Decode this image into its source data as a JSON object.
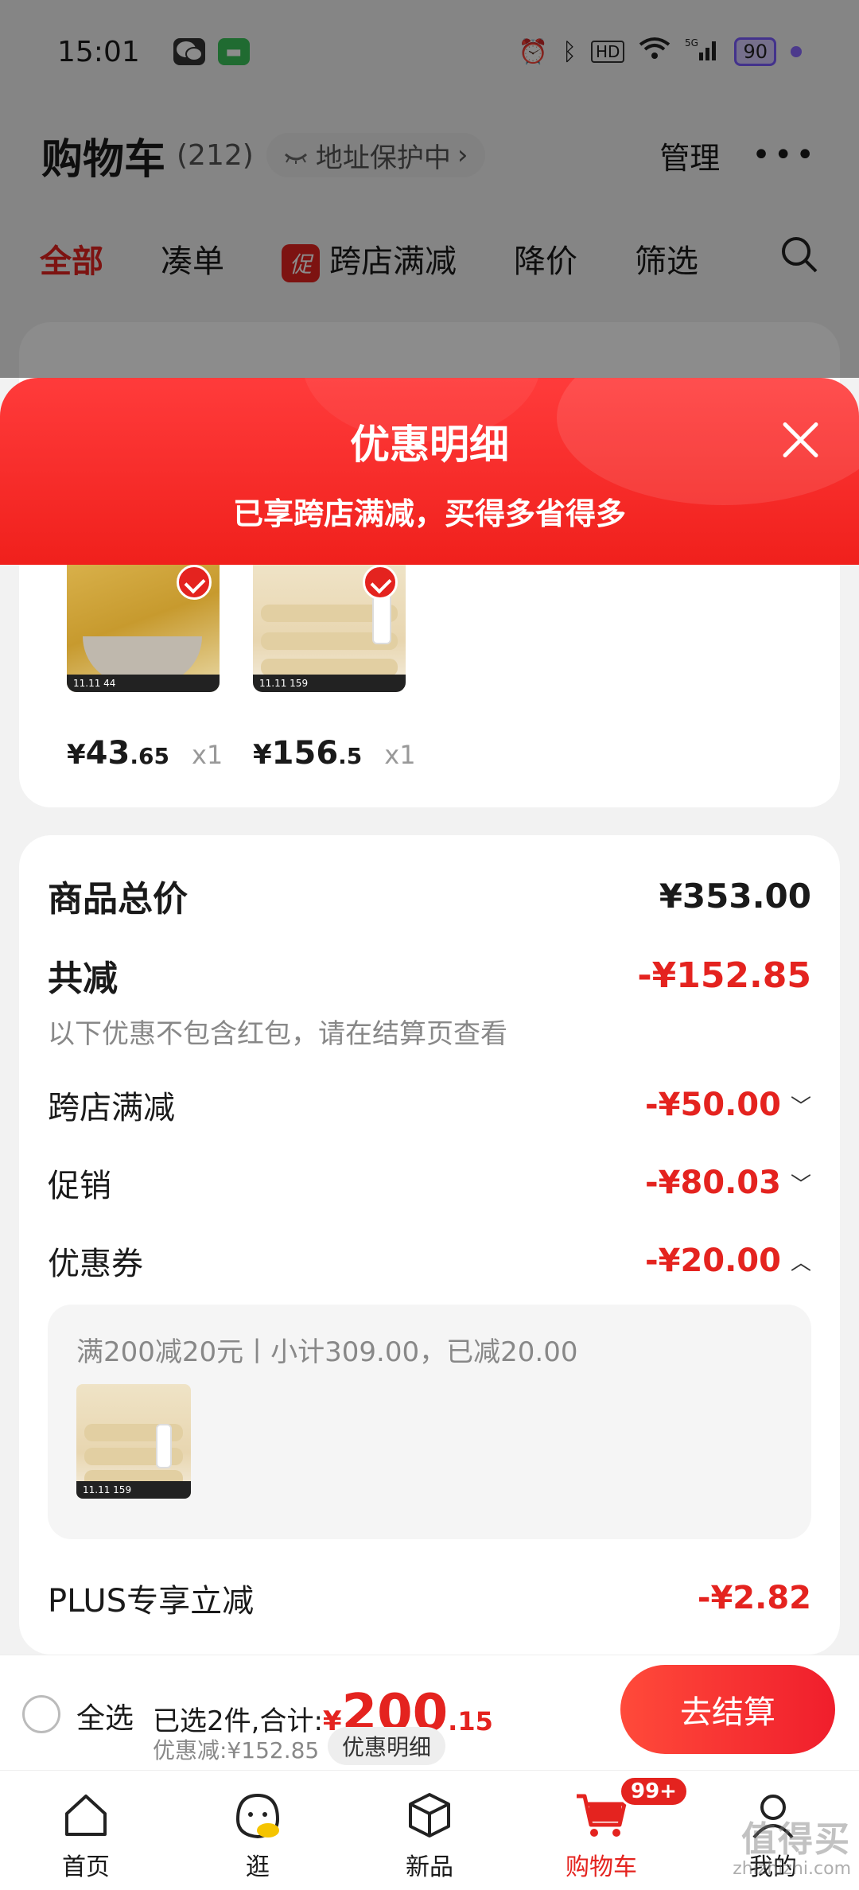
{
  "status_bar": {
    "time": "15:01",
    "battery": "90",
    "icons": [
      "wechat-icon",
      "message-app-icon",
      "alarm-icon",
      "bluetooth-icon",
      "hd-icon",
      "wifi-icon",
      "5g-signal-icon",
      "battery-icon"
    ]
  },
  "header": {
    "title": "购物车",
    "count": "(212)",
    "address_pill": "地址保护中",
    "manage": "管理",
    "more": "•••"
  },
  "filter_tabs": {
    "items": [
      "全部",
      "凑单",
      "跨店满减",
      "降价",
      "筛选"
    ],
    "promo_badge": "促",
    "active": "全部"
  },
  "sheet": {
    "title": "优惠明细",
    "subtitle": "已享跨店满减，买得多省得多"
  },
  "products": [
    {
      "price_yen": "¥",
      "price_int": "43",
      "price_dec": ".65",
      "qty": "x1",
      "strip": "11.11  44"
    },
    {
      "price_yen": "¥",
      "price_int": "156",
      "price_dec": ".5",
      "qty": "x1",
      "strip": "11.11  159"
    }
  ],
  "details": {
    "total_label": "商品总价",
    "total_value": "¥353.00",
    "saved_label": "共减",
    "saved_value": "-¥152.85",
    "note": "以下优惠不包含红包，请在结算页查看",
    "lines": [
      {
        "label": "跨店满减",
        "value": "-¥50.00",
        "chevron": "﹀"
      },
      {
        "label": "促销",
        "value": "-¥80.03",
        "chevron": "﹀"
      },
      {
        "label": "优惠券",
        "value": "-¥20.00",
        "chevron": "︿"
      }
    ],
    "coupon_desc": "满200减20元丨小计309.00，已减20.00",
    "plus_label": "PLUS专享立减",
    "plus_value": "-¥2.82"
  },
  "checkout": {
    "select_all": "全选",
    "selected_prefix": "已选2件,合计:",
    "total_yen": "¥",
    "total_int": "200",
    "total_dec": ".15",
    "saved_text": "优惠减:¥152.85",
    "detail_chip": "优惠明细",
    "button": "去结算"
  },
  "bottom_nav": {
    "items": [
      "首页",
      "逛",
      "新品",
      "购物车",
      "我的"
    ],
    "active": "购物车",
    "cart_badge": "99+"
  },
  "watermark": {
    "text": "值得买",
    "domain": "zhizhizhi.com"
  },
  "colors": {
    "accent": "#e4231f",
    "sheet_header": "#f0201c",
    "text_primary": "#1a1a1a",
    "text_muted": "#888888"
  }
}
